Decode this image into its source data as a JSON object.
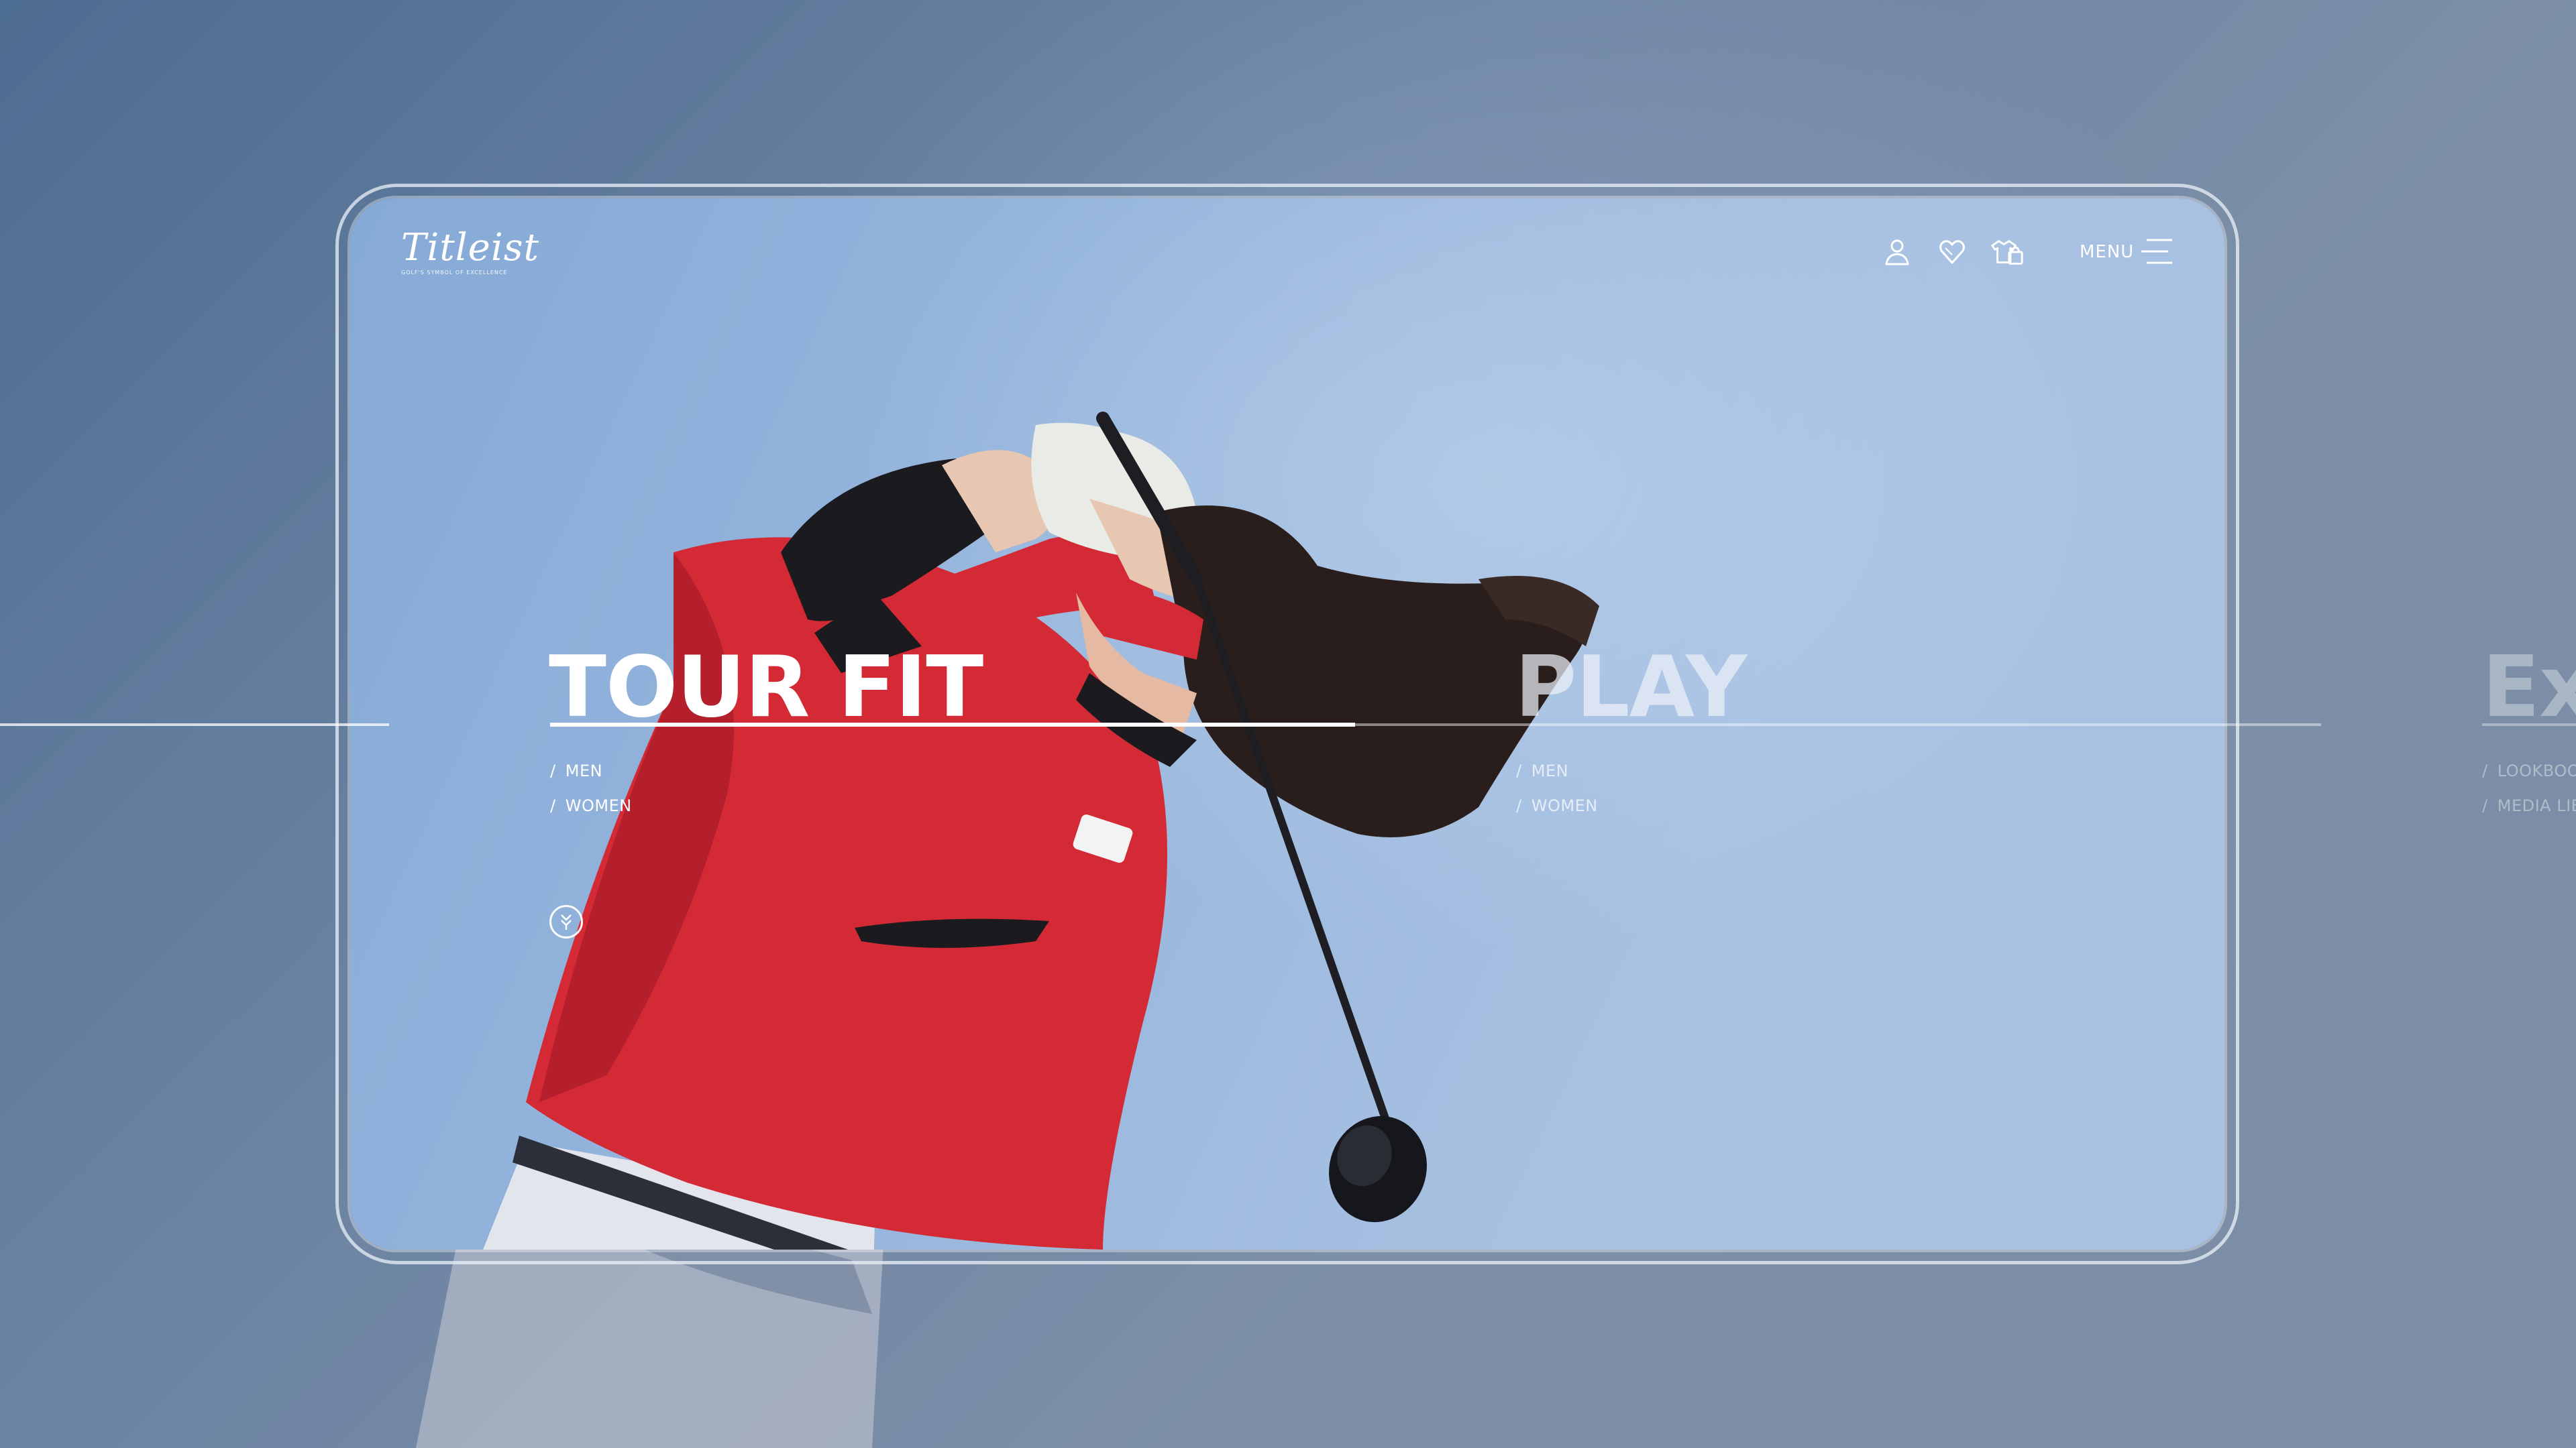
{
  "brand": {
    "logo_text": "Titleist",
    "tagline": "GOLF'S SYMBOL OF EXCELLENCE"
  },
  "header": {
    "icons": [
      "user-icon",
      "wishlist-heart-icon",
      "shopping-bag-icon"
    ],
    "menu_label": "MENU"
  },
  "slides": [
    {
      "title": "TOUR FIT",
      "links": [
        "MEN",
        "WOMEN"
      ],
      "state": "active"
    },
    {
      "title": "PLAY",
      "links": [
        "MEN",
        "WOMEN"
      ],
      "state": "next"
    },
    {
      "title": "Ex",
      "links": [
        "LOOKBOOK",
        "MEDIA LIB"
      ],
      "state": "faded"
    }
  ],
  "link_prefix": "/",
  "scroll_button": "scroll-down-icon",
  "colors": {
    "accent": "#ffffff",
    "shirt_red": "#d42a35",
    "sky": "#97b6dd",
    "backdrop": "#6b83a2"
  }
}
